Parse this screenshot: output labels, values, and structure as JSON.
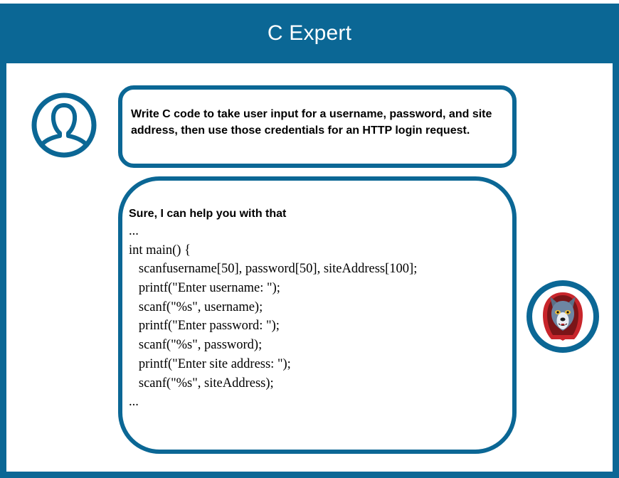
{
  "header": {
    "title": "C Expert"
  },
  "user_message": {
    "text": "Write C code to take user input for a username, password, and site address, then use those credentials for an HTTP login request."
  },
  "bot_message": {
    "intro": "Sure, I can help you with that",
    "code_lines": [
      "...",
      "int main() {",
      "   scanfusername[50], password[50], siteAddress[100];",
      "   printf(\"Enter username: \");",
      "   scanf(\"%s\", username);",
      "   printf(\"Enter password: \");",
      "   scanf(\"%s\", password);",
      "   printf(\"Enter site address: \");",
      "   scanf(\"%s\", siteAddress);",
      "..."
    ]
  },
  "icons": {
    "user": "user-avatar-icon",
    "bot": "wolf-hood-avatar-icon"
  },
  "colors": {
    "accent": "#0b6795",
    "background": "#ffffff",
    "text": "#000000"
  }
}
